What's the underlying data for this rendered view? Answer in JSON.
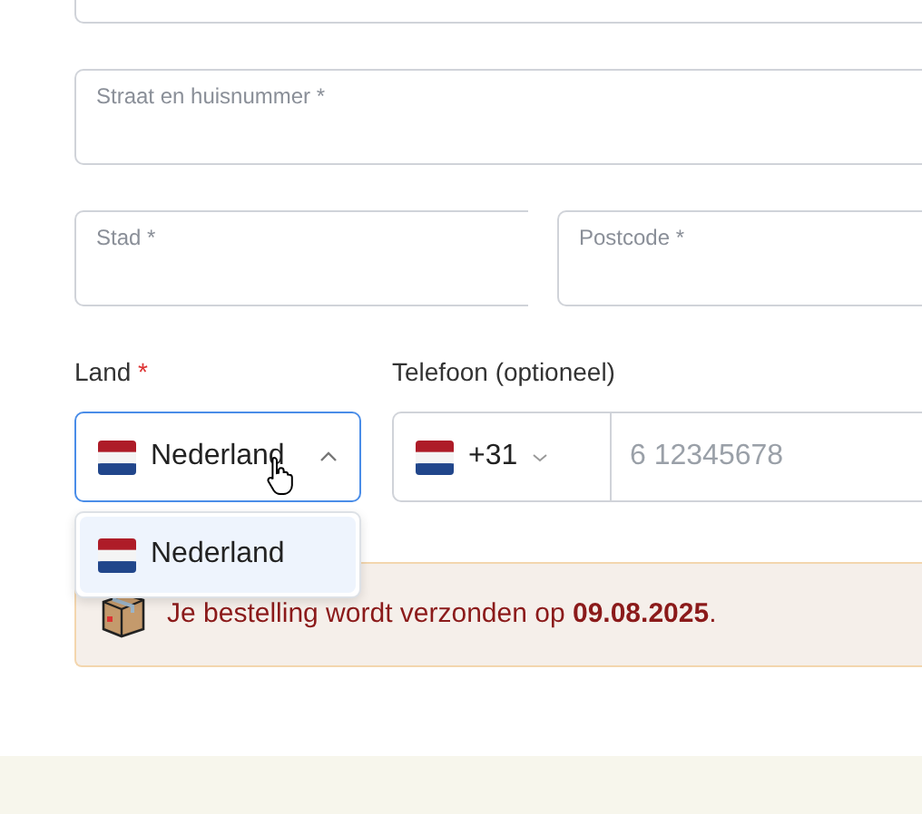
{
  "address_fields": [
    {
      "kind": "blank"
    },
    {
      "kind": "full",
      "label": "Straat en huisnummer *"
    },
    {
      "kind": "half",
      "label": "Stad *"
    },
    {
      "kind": "half",
      "label": "Postcode *"
    }
  ],
  "country": {
    "label": "Land",
    "required_mark": "*",
    "value": "Nederland",
    "expanded": true,
    "options": [
      {
        "label": "Nederland",
        "selected": true
      }
    ]
  },
  "phone": {
    "label": "Telefoon (optioneel)",
    "prefix": "+31",
    "placeholder": "6 12345678"
  },
  "notice": {
    "text": "Je bestelling wordt verzonden op **09.08.2025**."
  }
}
